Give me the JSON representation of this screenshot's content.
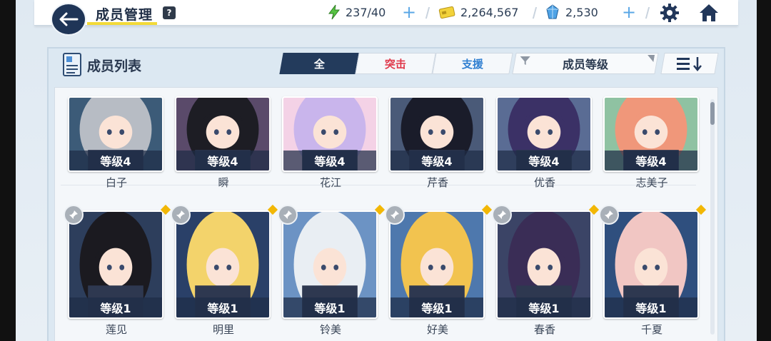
{
  "header": {
    "title": "成员管理",
    "help": "?",
    "stamina": "237/40",
    "credits": "2,264,567",
    "gems": "2,530"
  },
  "panel": {
    "title": "成员列表",
    "tabs": [
      "全",
      "突击",
      "支援"
    ],
    "sort_label": "成员等级"
  },
  "members_row1": [
    {
      "name": "白子",
      "level": "等级4",
      "hair": "#b7bcc4",
      "bg": "#3c5b78"
    },
    {
      "name": "瞬",
      "level": "等级4",
      "hair": "#1d1d24",
      "bg": "#5a4a6a"
    },
    {
      "name": "花江",
      "level": "等级4",
      "hair": "#c9b5ec",
      "bg": "#f4d2e6"
    },
    {
      "name": "芹香",
      "level": "等级4",
      "hair": "#1a1c2a",
      "bg": "#4a5a78"
    },
    {
      "name": "优香",
      "level": "等级4",
      "hair": "#3b3166",
      "bg": "#5a6c94"
    },
    {
      "name": "志美子",
      "level": "等级4",
      "hair": "#f0977a",
      "bg": "#8fc2a2"
    }
  ],
  "members_row2": [
    {
      "name": "莲见",
      "level": "等级1",
      "hair": "#1b1a20",
      "bg": "#2d3e5c"
    },
    {
      "name": "明里",
      "level": "等级1",
      "hair": "#f3d36b",
      "bg": "#2a4068"
    },
    {
      "name": "铃美",
      "level": "等级1",
      "hair": "#e9eef3",
      "bg": "#6c93c4"
    },
    {
      "name": "好美",
      "level": "等级1",
      "hair": "#f2c34f",
      "bg": "#4e78ad"
    },
    {
      "name": "春香",
      "level": "等级1",
      "hair": "#3a2d56",
      "bg": "#3b4466"
    },
    {
      "name": "千夏",
      "level": "等级1",
      "hair": "#f1c6c3",
      "bg": "#2f4f7e"
    }
  ]
}
